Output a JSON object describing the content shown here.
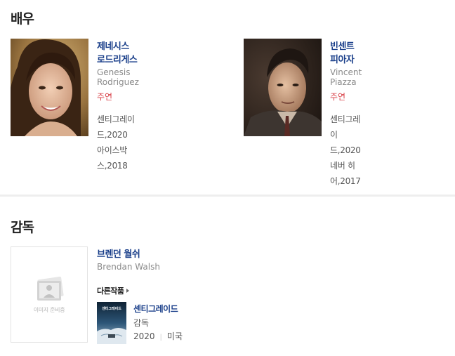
{
  "actors_section": {
    "title": "배우",
    "actors": [
      {
        "name_ko": "제네시스 로드리게스",
        "name_en": "Genesis Rodriguez",
        "role": "주연",
        "works": [
          "센티그레이드,2020",
          "아이스박스,2018"
        ]
      },
      {
        "name_ko": "빈센트 피아자",
        "name_en": "Vincent Piazza",
        "role": "주연",
        "works": [
          "센티그레이드,2020",
          "네버 히어,2017"
        ]
      }
    ]
  },
  "director_section": {
    "title": "감독",
    "director": {
      "name_ko": "브렌던 월쉬",
      "name_en": "Brendan Walsh",
      "image_placeholder": "이미지 준비중"
    },
    "other_works_label": "다른작품",
    "other_works": [
      {
        "title": "센티그레이드",
        "poster_text": "센티그레이드",
        "role": "감독",
        "year": "2020",
        "country": "미국"
      }
    ]
  },
  "colors": {
    "link_blue": "#1a3f8a",
    "role_red": "#d9434a",
    "muted_gray": "#8a8a8a"
  }
}
